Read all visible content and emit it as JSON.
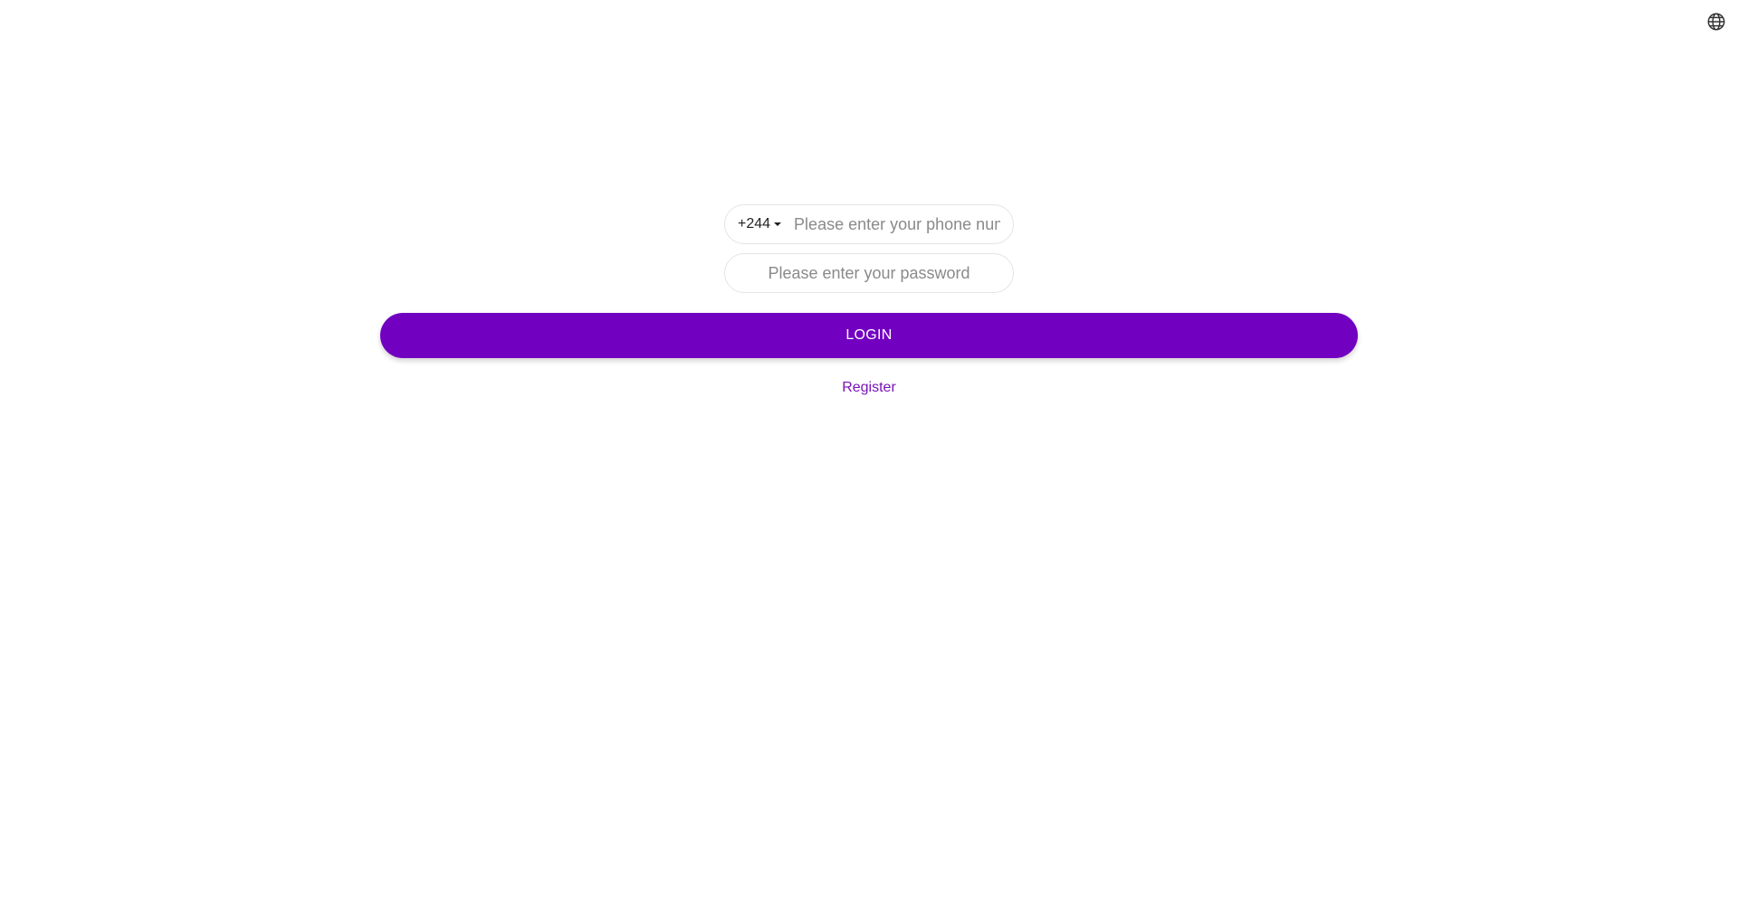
{
  "header": {
    "language_icon": "globe-icon"
  },
  "login_form": {
    "country_code": "+244",
    "country_code_icon": "caret-down-icon",
    "phone_placeholder": "Please enter your phone number",
    "phone_value": "",
    "password_placeholder": "Please enter your password",
    "password_value": "",
    "login_label": "LOGIN",
    "register_label": "Register"
  },
  "colors": {
    "primary": "#7200c0",
    "link": "#7a12b8",
    "input_border": "#e4e4e4",
    "placeholder": "#8a8a8a"
  }
}
